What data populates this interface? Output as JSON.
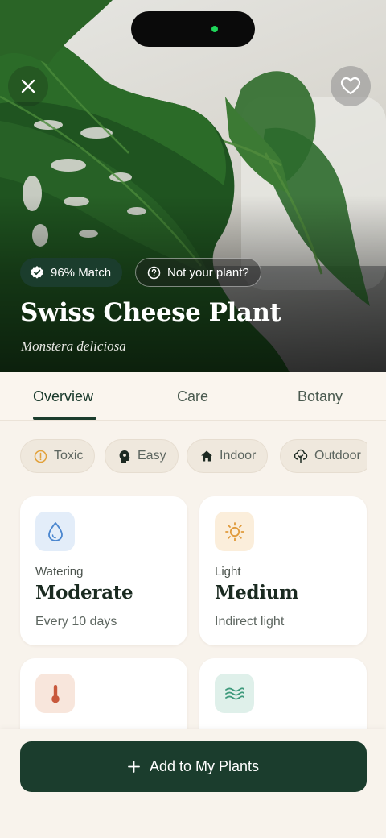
{
  "hero": {
    "match_label": "96% Match",
    "not_your_plant_label": "Not your plant?",
    "common_name": "Swiss Cheese Plant",
    "scientific_name": "Monstera deliciosa",
    "close_icon": "close-icon",
    "favorite_icon": "heart-icon"
  },
  "tabs": [
    {
      "label": "Overview",
      "active": true
    },
    {
      "label": "Care",
      "active": false
    },
    {
      "label": "Botany",
      "active": false
    }
  ],
  "chips": [
    {
      "label": "Toxic",
      "icon": "warning-info-icon",
      "icon_color": "#e2a13a"
    },
    {
      "label": "Easy",
      "icon": "head-icon",
      "icon_color": "#1d2a22"
    },
    {
      "label": "Indoor",
      "icon": "house-icon",
      "icon_color": "#1d2a22"
    },
    {
      "label": "Outdoor",
      "icon": "tree-icon",
      "icon_color": "#1d2a22"
    }
  ],
  "cards": [
    {
      "label": "Watering",
      "value": "Moderate",
      "sub": "Every 10 days",
      "icon": "water-drop-icon",
      "icon_bg": "#e3edf9",
      "icon_color": "#4a86cf"
    },
    {
      "label": "Light",
      "value": "Medium",
      "sub": "Indirect light",
      "icon": "sun-icon",
      "icon_bg": "#fbeedb",
      "icon_color": "#e09a3a"
    },
    {
      "label": "Temperature",
      "value": "",
      "sub": "",
      "icon": "thermometer-icon",
      "icon_bg": "#f8e6dc",
      "icon_color": "#c8593d"
    },
    {
      "label": "Humidity",
      "value": "",
      "sub": "",
      "icon": "waves-icon",
      "icon_bg": "#dff0ea",
      "icon_color": "#3e9a7c"
    }
  ],
  "cta": {
    "label": "Add to My Plants",
    "icon": "plus-icon"
  },
  "colors": {
    "primary": "#1b3d2d",
    "background": "#f8f3ec",
    "card": "#ffffff"
  }
}
